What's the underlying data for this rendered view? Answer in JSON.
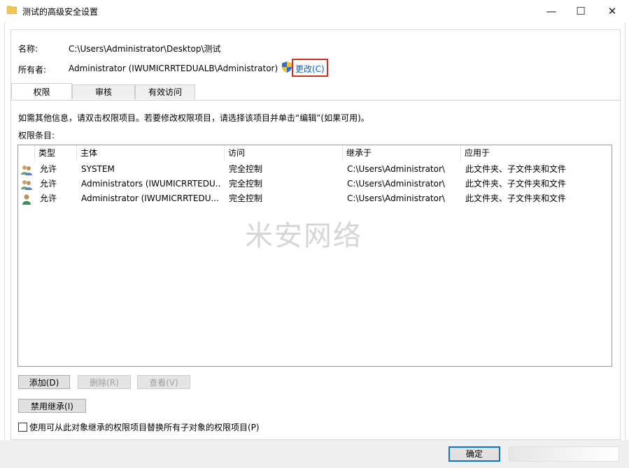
{
  "window": {
    "title": "测试的高级安全设置",
    "minimize": "—",
    "maximize": "☐",
    "close": "✕"
  },
  "header": {
    "name_label": "名称:",
    "name_value": "C:\\Users\\Administrator\\Desktop\\测试",
    "owner_label": "所有者:",
    "owner_value": "Administrator (IWUMICRRTEDUALB\\Administrator)",
    "change_link": "更改(C)"
  },
  "tabs": [
    {
      "label": "权限"
    },
    {
      "label": "审核"
    },
    {
      "label": "有效访问"
    }
  ],
  "permissions": {
    "info_text": "如需其他信息，请双击权限项目。若要修改权限项目，请选择该项目并单击“编辑”(如果可用)。",
    "entries_label": "权限条目:",
    "columns": [
      "类型",
      "主体",
      "访问",
      "继承于",
      "应用于"
    ],
    "rows": [
      {
        "icon": "group-icon",
        "type": "允许",
        "principal": "SYSTEM",
        "access": "完全控制",
        "inherited": "C:\\Users\\Administrator\\",
        "applies": "此文件夹、子文件夹和文件"
      },
      {
        "icon": "group-icon",
        "type": "允许",
        "principal": "Administrators (IWUMICRRTEDU...",
        "access": "完全控制",
        "inherited": "C:\\Users\\Administrator\\",
        "applies": "此文件夹、子文件夹和文件"
      },
      {
        "icon": "user-icon",
        "type": "允许",
        "principal": "Administrator (IWUMICRRTEDU...",
        "access": "完全控制",
        "inherited": "C:\\Users\\Administrator\\",
        "applies": "此文件夹、子文件夹和文件"
      }
    ],
    "watermark": "米安网络"
  },
  "buttons": {
    "add": "添加(D)",
    "remove": "删除(R)",
    "view": "查看(V)",
    "disable_inheritance": "禁用继承(I)",
    "replace_checkbox": "使用可从此对象继承的权限项目替换所有子对象的权限项目(P)",
    "ok": "确定"
  }
}
